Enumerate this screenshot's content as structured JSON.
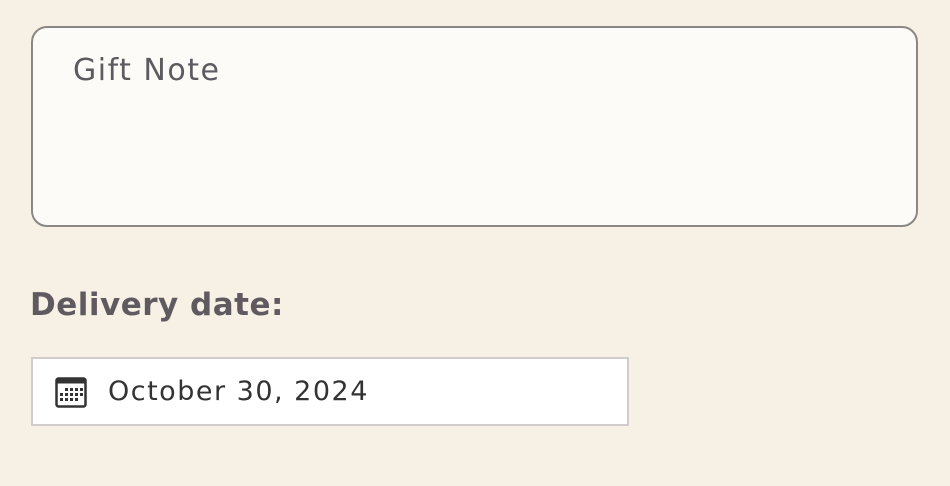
{
  "gift_note": {
    "placeholder": "Gift Note",
    "value": ""
  },
  "delivery": {
    "label": "Delivery date:",
    "date_value": "October 30, 2024",
    "icon": "calendar-icon"
  },
  "colors": {
    "background": "#f6f0e5",
    "text": "#5f5a60",
    "field_border": "#8b8785"
  }
}
